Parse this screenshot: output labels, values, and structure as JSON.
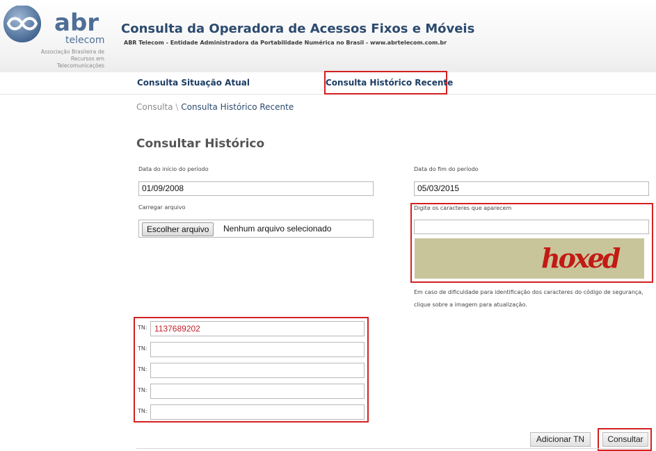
{
  "header": {
    "logo_name": "abr",
    "logo_sub": "telecom",
    "logo_caption": "Associação Brasileira de Recursos em Telecomunicações",
    "title": "Consulta da Operadora de Acessos Fixos e Móveis",
    "subtitle": "ABR Telecom - Entidade Administradora da Portabilidade Numérica no Brasil - www.abrtelecom.com.br"
  },
  "nav": {
    "items": [
      {
        "label": "Consulta Situação Atual"
      },
      {
        "label": "Consulta Histórico Recente"
      }
    ]
  },
  "breadcrumb": {
    "root": "Consulta",
    "separator": "\\",
    "current": "Consulta Histórico Recente"
  },
  "form": {
    "title": "Consultar Histórico",
    "start_label": "Data do início do período",
    "start_value": "01/09/2008",
    "end_label": "Data do fim do período",
    "end_value": "05/03/2015",
    "file_label": "Carregar arquivo",
    "file_button": "Escolher arquivo",
    "file_status": "Nenhum arquivo selecionado",
    "captcha_label": "Digite os caracteres que aparecem",
    "captcha_value": "",
    "captcha_text": "hoxed",
    "help_text": "Em caso de dificuldade para identificação dos caracteres do código de segurança, clique sobre a imagem para atualização."
  },
  "tn": {
    "label": "TN:",
    "fields": [
      "1137689202",
      "",
      "",
      "",
      ""
    ]
  },
  "buttons": {
    "add": "Adicionar TN",
    "submit": "Consultar"
  },
  "colors": {
    "highlight": "#d42020",
    "nav_text": "#1d3d63",
    "title": "#2c4a6e"
  }
}
